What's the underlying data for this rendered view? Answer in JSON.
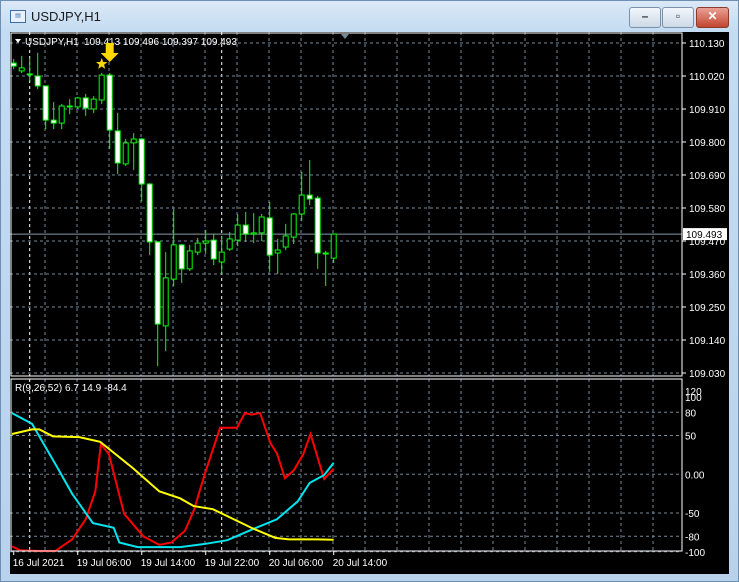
{
  "window": {
    "title": "USDJPY,H1",
    "minimize": "–",
    "maximize": "▫",
    "close": "✕"
  },
  "colors": {
    "bull_border": "#00ff00",
    "bear_fill": "#ffffff",
    "grid": "#778899",
    "line1": "#ff0000",
    "line2": "#00e5ee",
    "line3": "#ffff00",
    "marker": "#ffd700"
  },
  "main": {
    "header": "USDJPY,H1",
    "ohlc": "109.413 109.496 109.397 109.493",
    "current_price": "109.493",
    "price_labels": [
      "110.130",
      "110.020",
      "109.910",
      "109.800",
      "109.690",
      "109.580",
      "109.470",
      "109.360",
      "109.250",
      "109.140",
      "109.030"
    ],
    "signal_marker_bar": 12,
    "candles": [
      [
        110.063,
        110.077,
        110.043,
        110.053
      ],
      [
        110.037,
        110.087,
        110.03,
        110.047
      ],
      [
        110.027,
        110.08,
        110.003,
        110.027
      ],
      [
        110.02,
        110.097,
        109.977,
        109.987
      ],
      [
        109.987,
        109.987,
        109.843,
        109.873
      ],
      [
        109.873,
        109.933,
        109.843,
        109.863
      ],
      [
        109.863,
        109.927,
        109.843,
        109.92
      ],
      [
        109.92,
        109.943,
        109.893,
        109.917
      ],
      [
        109.917,
        109.95,
        109.91,
        109.947
      ],
      [
        109.947,
        109.96,
        109.887,
        109.913
      ],
      [
        109.91,
        109.953,
        109.897,
        109.943
      ],
      [
        109.94,
        110.03,
        109.927,
        110.023
      ],
      [
        110.023,
        110.03,
        109.777,
        109.84
      ],
      [
        109.837,
        109.897,
        109.693,
        109.73
      ],
      [
        109.727,
        109.81,
        109.72,
        109.797
      ],
      [
        109.797,
        109.83,
        109.707,
        109.81
      ],
      [
        109.81,
        109.813,
        109.603,
        109.66
      ],
      [
        109.66,
        109.663,
        109.423,
        109.467
      ],
      [
        109.467,
        109.47,
        109.053,
        109.193
      ],
      [
        109.187,
        109.433,
        109.103,
        109.347
      ],
      [
        109.343,
        109.577,
        109.32,
        109.457
      ],
      [
        109.457,
        109.46,
        109.33,
        109.377
      ],
      [
        109.377,
        109.457,
        109.37,
        109.437
      ],
      [
        109.433,
        109.48,
        109.423,
        109.463
      ],
      [
        109.463,
        109.507,
        109.427,
        109.47
      ],
      [
        109.473,
        109.493,
        109.39,
        109.41
      ],
      [
        109.4,
        109.487,
        109.363,
        109.433
      ],
      [
        109.443,
        109.5,
        109.437,
        109.477
      ],
      [
        109.473,
        109.56,
        109.453,
        109.523
      ],
      [
        109.523,
        109.567,
        109.467,
        109.493
      ],
      [
        109.493,
        109.563,
        109.463,
        109.497
      ],
      [
        109.497,
        109.56,
        109.47,
        109.55
      ],
      [
        109.547,
        109.6,
        109.367,
        109.423
      ],
      [
        109.43,
        109.477,
        109.36,
        109.44
      ],
      [
        109.45,
        109.527,
        109.44,
        109.487
      ],
      [
        109.483,
        109.563,
        109.46,
        109.56
      ],
      [
        109.56,
        109.7,
        109.537,
        109.623
      ],
      [
        109.623,
        109.74,
        109.59,
        109.61
      ],
      [
        109.613,
        109.62,
        109.377,
        109.43
      ],
      [
        109.43,
        109.437,
        109.32,
        109.427
      ],
      [
        109.413,
        109.496,
        109.397,
        109.493
      ]
    ]
  },
  "indicator": {
    "header": "R(9,26,52) 6.7 14.9 -84.4",
    "levels": [
      "120",
      "100",
      "80",
      "50",
      "0.00",
      "-50",
      "-80",
      "-100"
    ],
    "level_values": [
      120,
      100,
      80,
      50,
      0,
      -50,
      -80,
      -100
    ],
    "series": [
      {
        "name": "red",
        "points": [
          [
            -0.2,
            -93
          ],
          [
            0.8,
            -98
          ],
          [
            3.2,
            -99
          ],
          [
            5.2,
            -99
          ],
          [
            7.3,
            -84
          ],
          [
            9,
            -58
          ],
          [
            10.2,
            -22
          ],
          [
            10.9,
            39
          ],
          [
            11.9,
            26
          ],
          [
            13.8,
            -51
          ],
          [
            16.2,
            -80
          ],
          [
            18.2,
            -91
          ],
          [
            19.7,
            -88
          ],
          [
            21.4,
            -73
          ],
          [
            22.5,
            -47
          ],
          [
            24,
            4
          ],
          [
            25.8,
            60
          ],
          [
            27.9,
            60
          ],
          [
            28.9,
            79
          ],
          [
            29.7,
            77
          ],
          [
            30.8,
            79
          ],
          [
            32.1,
            40
          ],
          [
            32.9,
            27
          ],
          [
            33.9,
            -5
          ],
          [
            35,
            5
          ],
          [
            36.2,
            26
          ],
          [
            37.1,
            52
          ],
          [
            38.8,
            -6
          ],
          [
            40,
            7
          ]
        ]
      },
      {
        "name": "cyan",
        "points": [
          [
            -0.2,
            79
          ],
          [
            2.3,
            65
          ],
          [
            5.5,
            8
          ],
          [
            7.3,
            -25
          ],
          [
            9.9,
            -63
          ],
          [
            12.5,
            -69
          ],
          [
            13.2,
            -88
          ],
          [
            15.5,
            -94
          ],
          [
            20.8,
            -94
          ],
          [
            23.8,
            -90
          ],
          [
            26.7,
            -85
          ],
          [
            30.3,
            -69
          ],
          [
            32.9,
            -58
          ],
          [
            35.5,
            -35
          ],
          [
            37,
            -11
          ],
          [
            38.8,
            -1
          ],
          [
            40,
            14.9
          ]
        ]
      },
      {
        "name": "yellow",
        "points": [
          [
            -0.2,
            52
          ],
          [
            2.3,
            58
          ],
          [
            3.2,
            58
          ],
          [
            4.9,
            49
          ],
          [
            8.2,
            48
          ],
          [
            10.8,
            42
          ],
          [
            14.9,
            8
          ],
          [
            18.2,
            -22
          ],
          [
            20.8,
            -31
          ],
          [
            22.5,
            -41
          ],
          [
            24.9,
            -45
          ],
          [
            26.7,
            -54
          ],
          [
            29.7,
            -69
          ],
          [
            32.7,
            -82
          ],
          [
            34.4,
            -84
          ],
          [
            37.9,
            -84
          ],
          [
            40,
            -84.4
          ]
        ]
      }
    ]
  },
  "time_labels": [
    {
      "bar": 0,
      "label": "16 Jul 2021"
    },
    {
      "bar": 8,
      "label": "19 Jul 06:00"
    },
    {
      "bar": 16,
      "label": "19 Jul 14:00"
    },
    {
      "bar": 24,
      "label": "19 Jul 22:00"
    },
    {
      "bar": 32,
      "label": "20 Jul 06:00"
    },
    {
      "bar": 40,
      "label": "20 Jul 14:00"
    }
  ],
  "day_separator_bars": [
    2,
    26
  ]
}
